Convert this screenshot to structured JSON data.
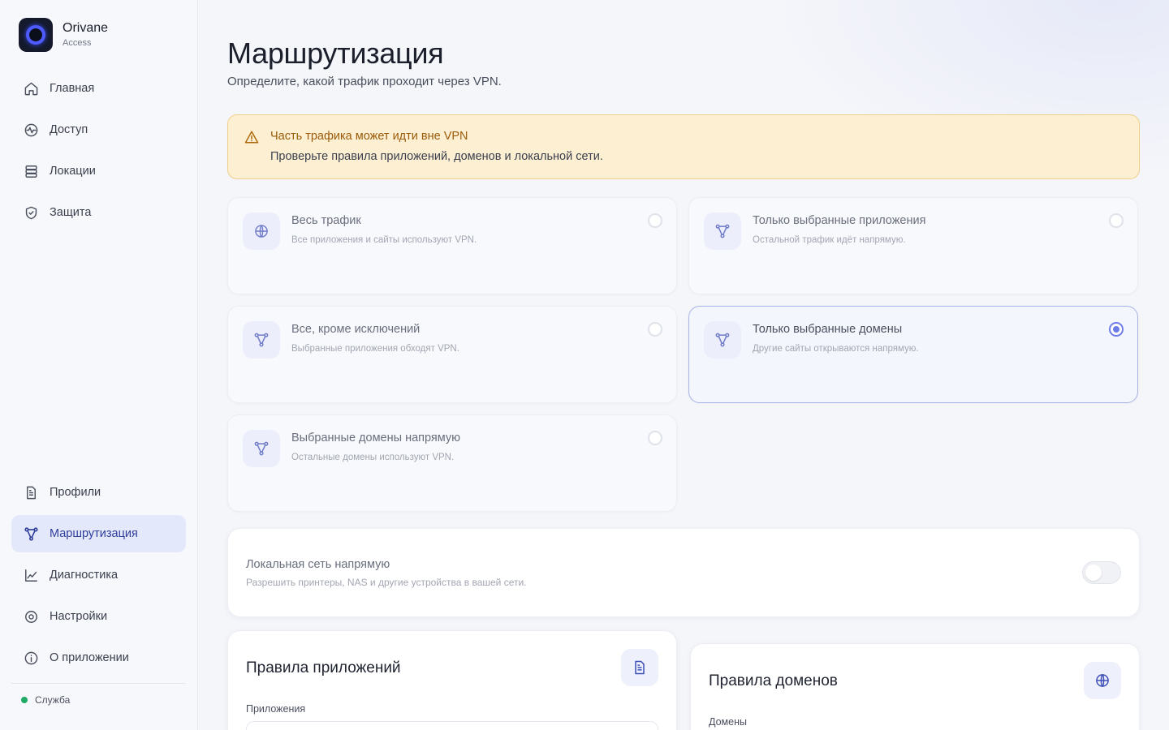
{
  "app": {
    "name": "Orivane",
    "edition": "Access"
  },
  "sidebar": {
    "top_items": [
      {
        "label": "Главная",
        "icon": "home-icon"
      },
      {
        "label": "Доступ",
        "icon": "activity-icon"
      },
      {
        "label": "Локации",
        "icon": "server-icon"
      },
      {
        "label": "Защита",
        "icon": "shield-icon"
      }
    ],
    "bottom_items": [
      {
        "label": "Профили",
        "icon": "document-icon"
      },
      {
        "label": "Маршрутизация",
        "icon": "routing-icon",
        "active": true
      },
      {
        "label": "Диагностика",
        "icon": "chart-icon"
      },
      {
        "label": "Настройки",
        "icon": "gear-icon"
      },
      {
        "label": "О приложении",
        "icon": "info-icon"
      }
    ],
    "service_label": "Служба",
    "service_status_color": "#1faa66"
  },
  "page": {
    "title": "Маршрутизация",
    "subtitle": "Определите, какой трафик проходит через VPN."
  },
  "alert": {
    "title": "Часть трафика может идти вне VPN",
    "text": "Проверьте правила приложений, доменов и локальной сети."
  },
  "modes": [
    {
      "title": "Весь трафик",
      "desc": "Все приложения и сайты используют VPN.",
      "icon": "globe-icon",
      "selected": false
    },
    {
      "title": "Только выбранные приложения",
      "desc": "Остальной трафик идёт напрямую.",
      "icon": "routing-icon",
      "selected": false
    },
    {
      "title": "Все, кроме исключений",
      "desc": "Выбранные приложения обходят VPN.",
      "icon": "routing-icon",
      "selected": false
    },
    {
      "title": "Только выбранные домены",
      "desc": "Другие сайты открываются напрямую.",
      "icon": "routing-icon",
      "selected": true
    },
    {
      "title": "Выбранные домены напрямую",
      "desc": "Остальные домены используют VPN.",
      "icon": "routing-icon",
      "selected": false
    }
  ],
  "lan": {
    "title": "Локальная сеть напрямую",
    "desc": "Разрешить принтеры, NAS и другие устройства в вашей сети.",
    "enabled": false
  },
  "app_rules": {
    "title": "Правила приложений",
    "label": "Приложения",
    "icon": "document-icon"
  },
  "domain_rules": {
    "title": "Правила доменов",
    "label": "Домены",
    "icon": "globe-icon"
  },
  "colors": {
    "accent": "#2f3d9b",
    "warning_bg": "#fdefd2",
    "warning_text": "#9a5b0a",
    "radio_selected": "#6e7ce8"
  }
}
